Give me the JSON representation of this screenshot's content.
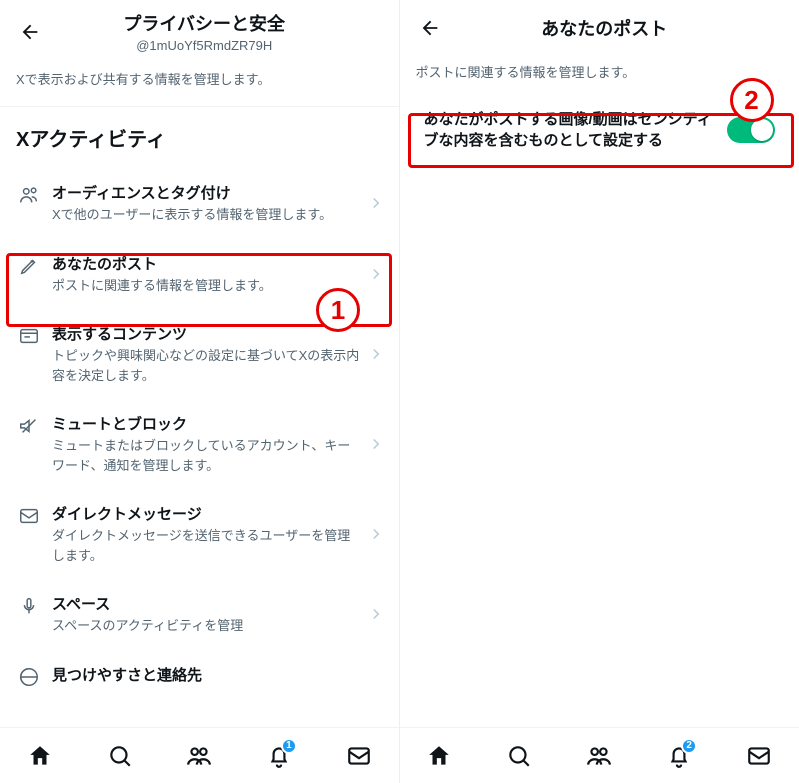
{
  "left": {
    "header": {
      "title": "プライバシーと安全",
      "sub": "@1mUoYf5RmdZR79H"
    },
    "desc": "Xで表示および共有する情報を管理します。",
    "section": "Xアクティビティ",
    "rows": [
      {
        "icon": "people-icon",
        "title": "オーディエンスとタグ付け",
        "sub": "Xで他のユーザーに表示する情報を管理します。"
      },
      {
        "icon": "pencil-icon",
        "title": "あなたのポスト",
        "sub": "ポストに関連する情報を管理します。"
      },
      {
        "icon": "content-icon",
        "title": "表示するコンテンツ",
        "sub": "トピックや興味関心などの設定に基づいてXの表示内容を決定します。"
      },
      {
        "icon": "mute-icon",
        "title": "ミュートとブロック",
        "sub": "ミュートまたはブロックしているアカウント、キーワード、通知を管理します。"
      },
      {
        "icon": "dm-icon",
        "title": "ダイレクトメッセージ",
        "sub": "ダイレクトメッセージを送信できるユーザーを管理します。"
      },
      {
        "icon": "spaces-icon",
        "title": "スペース",
        "sub": "スペースのアクティビティを管理"
      },
      {
        "icon": "discover-icon",
        "title": "見つけやすさと連絡先",
        "sub": ""
      }
    ]
  },
  "right": {
    "header": {
      "title": "あなたのポスト"
    },
    "desc": "ポストに関連する情報を管理します。",
    "toggle": {
      "label": "あなたがポストする画像/動画はセンシティブな内容を含むものとして設定する",
      "on": true
    }
  },
  "nav": {
    "notif_left_badge": "1",
    "notif_right_badge": "2"
  },
  "callouts": {
    "one": "1",
    "two": "2"
  },
  "colors": {
    "accent": "#1d9bf0",
    "toggle_on": "#00ba7c",
    "highlight": "#e60000"
  }
}
